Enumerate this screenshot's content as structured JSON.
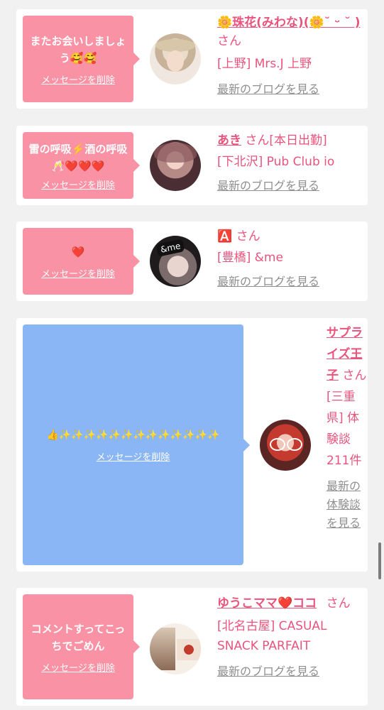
{
  "delete_label": "メッセージを削除",
  "cards": [
    {
      "message": "またお会いしましょう🥰🥰",
      "name": "🌼珠花(みわな)(🌼˘ ᵕ ˘ )",
      "san": "さん",
      "store": "[上野] Mrs.J 上野",
      "link": "最新のブログを見る"
    },
    {
      "message": "雷の呼吸⚡️酒の呼吸🥂❤️❤️❤️",
      "name": "あき",
      "san": "さん[本日出勤]",
      "store": "[下北沢] Pub Club io",
      "link": "最新のブログを見る"
    },
    {
      "message": "❤️",
      "name": "🅰️",
      "san": "さん",
      "store": "[豊橋] &me",
      "avatar_text": "&me",
      "link": "最新のブログを見る"
    },
    {
      "message": "👍✨✨✨✨✨✨✨✨✨✨✨✨✨",
      "name": "サプライズ王子",
      "san": "さん",
      "store": "[三重県] 体験談 211件",
      "link": "最新の体験談を見る"
    },
    {
      "message": "コメントすってこっちでごめん",
      "name": "ゆうこママ❤️ココ",
      "san": "さん",
      "store": "[北名古屋] CASUAL SNACK PARFAIT",
      "link": "最新のブログを見る"
    }
  ],
  "colors": {
    "pink_bubble": "#f992a4",
    "blue_bubble": "#8ab6f5",
    "accent": "#e9547d",
    "link_gray": "#8f8f8f"
  }
}
